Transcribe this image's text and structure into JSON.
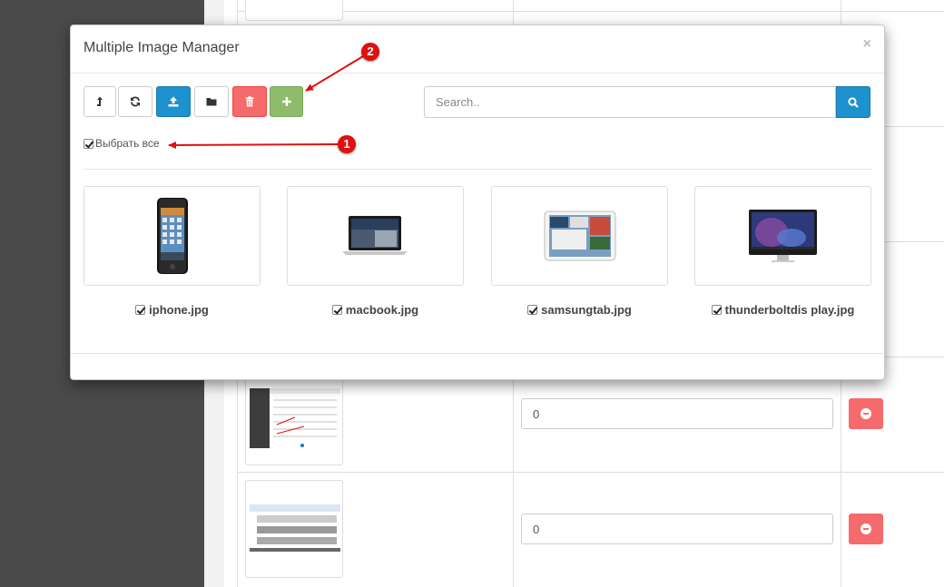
{
  "modal": {
    "title": "Multiple Image Manager",
    "close_glyph": "×",
    "toolbar": {
      "parent_icon": "level-up-icon",
      "refresh_icon": "refresh-icon",
      "upload_icon": "upload-icon",
      "new_folder_icon": "folder-icon",
      "delete_icon": "trash-icon",
      "add_icon": "plus-icon"
    },
    "search": {
      "placeholder": "Search..",
      "value": ""
    },
    "select_all": {
      "label": "Выбрать все",
      "checked": true
    },
    "images": [
      {
        "name": "iphone.jpg",
        "checked": true
      },
      {
        "name": "macbook.jpg",
        "checked": true
      },
      {
        "name": "samsungtab.jpg",
        "checked": true
      },
      {
        "name": "thunderboltdis play.jpg",
        "checked": true
      }
    ]
  },
  "annotations": [
    {
      "number": "1"
    },
    {
      "number": "2"
    }
  ],
  "background": {
    "rows": [
      {
        "sort_value": "0"
      },
      {
        "sort_value": "0"
      }
    ]
  },
  "colors": {
    "primary": "#1e91cf",
    "danger": "#f56b6b",
    "success": "#8fbb6c",
    "annotation": "#e01010"
  }
}
